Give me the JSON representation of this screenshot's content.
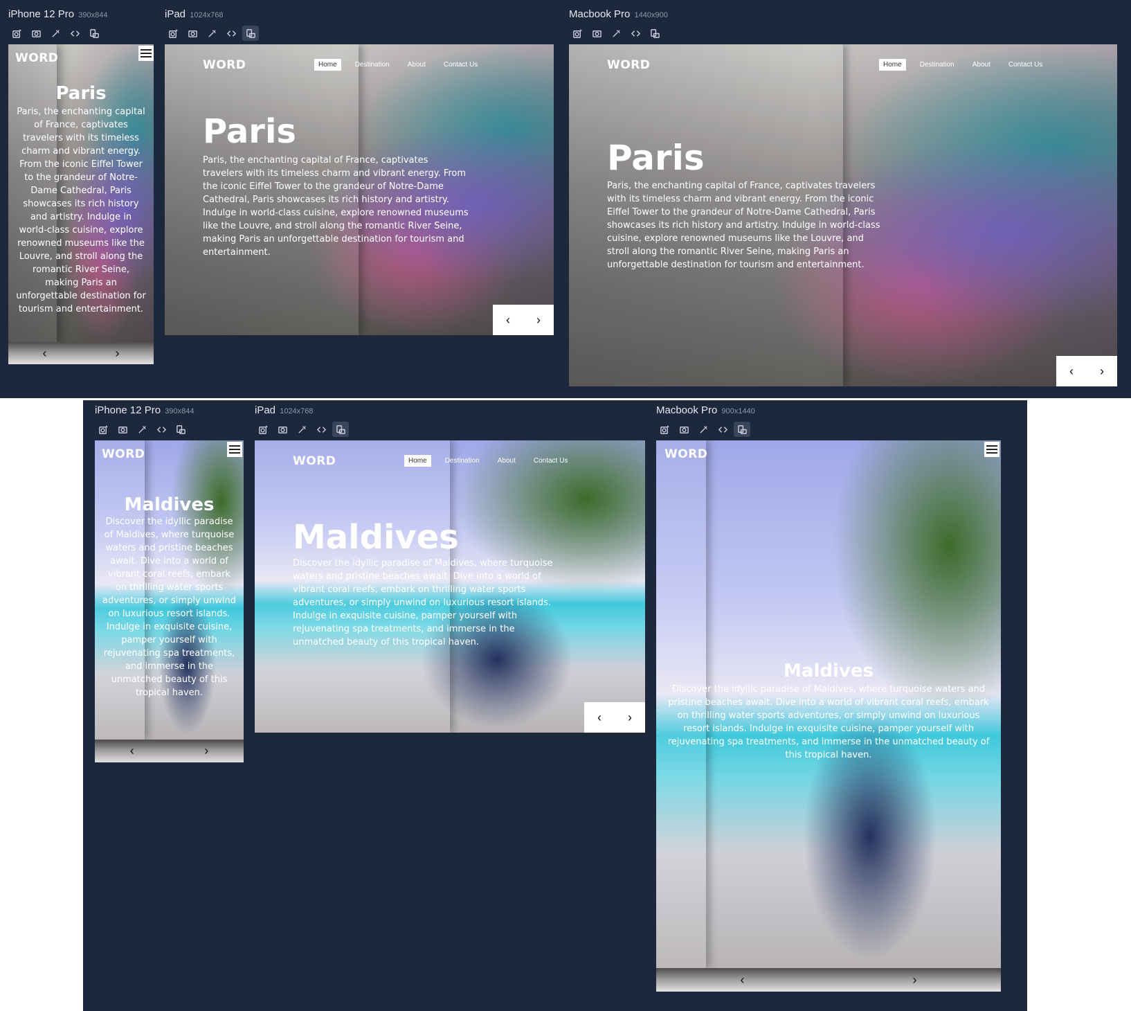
{
  "brand": "WORD",
  "nav": [
    "Home",
    "Destination",
    "About",
    "Contact Us"
  ],
  "prev_glyph": "‹",
  "next_glyph": "›",
  "toolbar_icons": [
    "screenshot-settings-icon",
    "camera-icon",
    "eyedropper-icon",
    "code-icon",
    "rotate-device-icon"
  ],
  "devices": {
    "top_iphone": {
      "name": "iPhone 12 Pro",
      "size": "390x844"
    },
    "top_ipad": {
      "name": "iPad",
      "size": "1024x768"
    },
    "top_macbook": {
      "name": "Macbook Pro",
      "size": "1440x900"
    },
    "bottom_iphone": {
      "name": "iPhone 12 Pro",
      "size": "390x844"
    },
    "bottom_ipad": {
      "name": "iPad",
      "size": "1024x768"
    },
    "bottom_macbook": {
      "name": "Macbook Pro",
      "size": "900x1440"
    }
  },
  "paris": {
    "title": "Paris",
    "text": "Paris, the enchanting capital of France, captivates travelers with its timeless charm and vibrant energy. From the iconic Eiffel Tower to the grandeur of Notre-Dame Cathedral, Paris showcases its rich history and artistry. Indulge in world-class cuisine, explore renowned museums like the Louvre, and stroll along the romantic River Seine, making Paris an unforgettable destination for tourism and entertainment."
  },
  "maldives": {
    "title": "Maldives",
    "text": "Discover the idyllic paradise of Maldives, where turquoise waters and pristine beaches await. Dive into a world of vibrant coral reefs, embark on thrilling water sports adventures, or simply unwind on luxurious resort islands. Indulge in exquisite cuisine, pamper yourself with rejuvenating spa treatments, and immerse in the unmatched beauty of this tropical haven."
  }
}
